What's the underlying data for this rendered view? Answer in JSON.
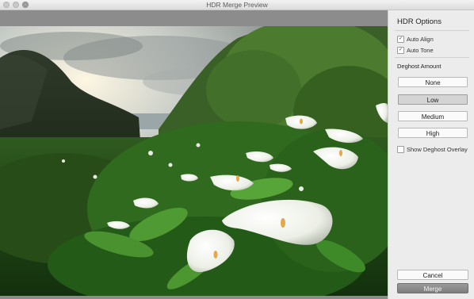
{
  "window": {
    "title": "HDR Merge Preview"
  },
  "panel": {
    "title": "HDR Options",
    "auto_align": {
      "label": "Auto Align",
      "checked": true
    },
    "auto_tone": {
      "label": "Auto Tone",
      "checked": true
    },
    "deghost_label": "Deghost Amount",
    "deghost_options": [
      "None",
      "Low",
      "Medium",
      "High"
    ],
    "deghost_selected": "Low",
    "show_overlay": {
      "label": "Show Deghost Overlay",
      "checked": false
    },
    "cancel_label": "Cancel",
    "merge_label": "Merge"
  },
  "preview": {
    "image_subject": "calla-lily-coastal-landscape-photo"
  }
}
